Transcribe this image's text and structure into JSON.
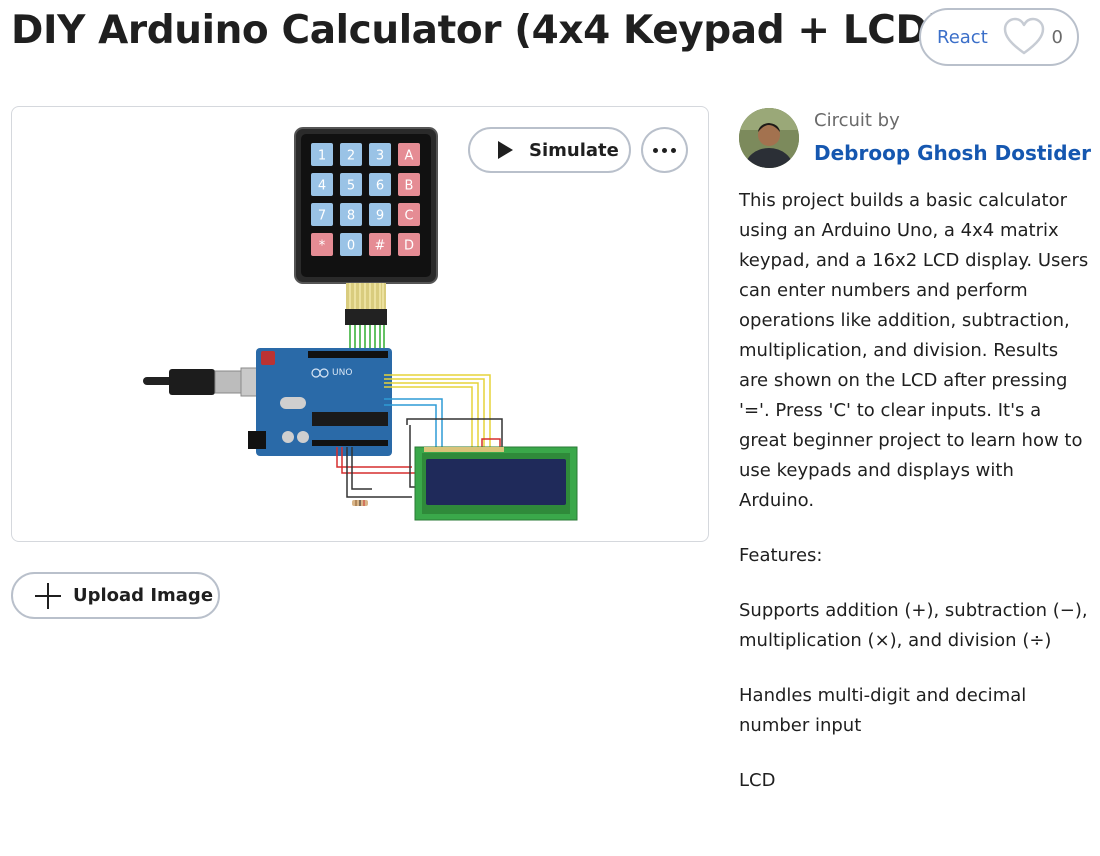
{
  "title": "DIY Arduino Calculator (4x4 Keypad + LCD)",
  "react": {
    "label": "React",
    "count": "0",
    "icon": "heart-icon"
  },
  "canvas": {
    "simulate_label": "Simulate",
    "simulate_icon": "play-icon",
    "more_icon": "more-dots-icon",
    "keypad_keys": [
      "1",
      "2",
      "3",
      "A",
      "4",
      "5",
      "6",
      "B",
      "7",
      "8",
      "9",
      "C",
      "*",
      "0",
      "#",
      "D"
    ],
    "board_label": "UNO"
  },
  "upload": {
    "label": "Upload Image",
    "icon": "plus-icon"
  },
  "author": {
    "by_label": "Circuit by",
    "name": "Debroop Ghosh Dostider"
  },
  "description": {
    "paragraphs": [
      "This project builds a basic calculator using an Arduino Uno, a 4x4 matrix keypad, and a 16x2 LCD display. Users can enter numbers and perform operations like addition, subtraction, multiplication, and division. Results are shown on the LCD after pressing '='. Press 'C' to clear inputs. It's a great beginner project to learn how to use keypads and displays with Arduino.",
      "Features:",
      "Supports addition (+), subtraction (−), multiplication (×), and division (÷)",
      "Handles multi-digit and decimal number input",
      "LCD"
    ]
  },
  "colors": {
    "link": "#1557b0",
    "react_text": "#3b6fc9",
    "border": "#b9c0cb",
    "keypad_blue_key": "#9ac3e6",
    "keypad_red_key": "#e58c94",
    "board_blue": "#2a6aa8",
    "lcd_green": "#3aa84a",
    "lcd_screen": "#1f2a5a"
  }
}
